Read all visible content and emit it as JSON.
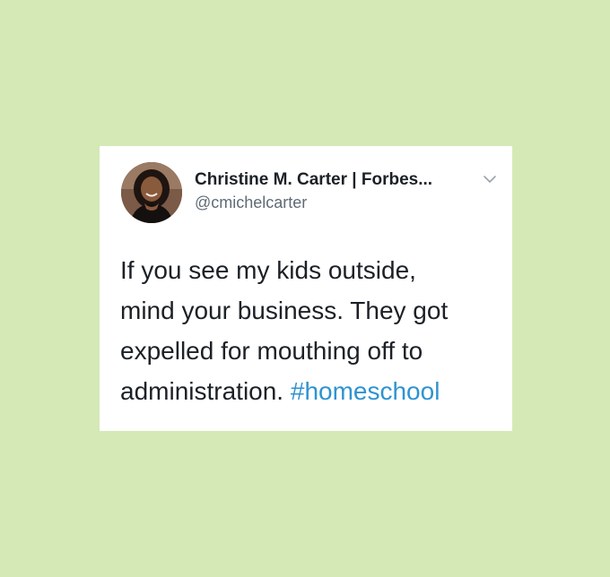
{
  "tweet": {
    "author": {
      "display_name": "Christine M. Carter | Forbes...",
      "handle": "@cmichelcarter",
      "avatar_icon": "profile-photo"
    },
    "menu_icon": "chevron-down-icon",
    "lines": [
      "If you see my kids outside,",
      "mind your business. They got",
      "expelled for mouthing off to",
      "administration."
    ],
    "hashtag": "#homeschool"
  },
  "colors": {
    "background": "#d5e9b6",
    "card": "#ffffff",
    "text": "#1c2127",
    "muted": "#5f6b76",
    "hashtag": "#2f93d1"
  }
}
